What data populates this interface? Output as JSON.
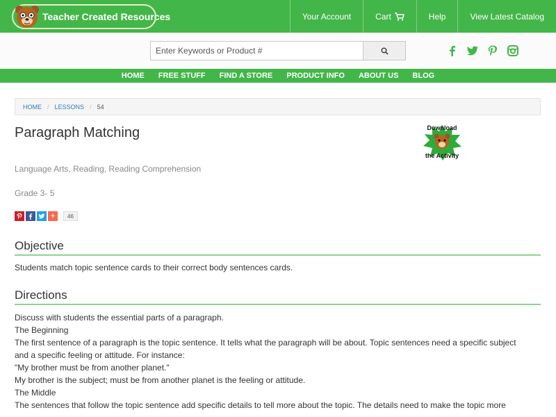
{
  "header": {
    "logo_text": "Teacher Created Resources",
    "nav": [
      {
        "label": "Your Account"
      },
      {
        "label": "Cart"
      },
      {
        "label": "Help"
      },
      {
        "label": "View Latest Catalog"
      }
    ]
  },
  "search": {
    "placeholder": "Enter Keywords or Product #",
    "value": ""
  },
  "social_icons": [
    "facebook-icon",
    "twitter-icon",
    "pinterest-icon",
    "instagram-icon"
  ],
  "main_nav": [
    {
      "label": "HOME"
    },
    {
      "label": "FREE STUFF"
    },
    {
      "label": "FIND A STORE"
    },
    {
      "label": "PRODUCT INFO"
    },
    {
      "label": "ABOUT US"
    },
    {
      "label": "BLOG"
    }
  ],
  "breadcrumb": [
    {
      "label": "HOME"
    },
    {
      "label": "LESSONS"
    },
    {
      "label": "54"
    }
  ],
  "lesson": {
    "title": "Paragraph Matching",
    "download_badge": {
      "line1": "Download",
      "line2": "the Activity"
    },
    "subjects": "Language Arts, Reading, Reading Comprehension",
    "grade": "Grade 3- 5",
    "share_count": "46",
    "objective_heading": "Objective",
    "objective_text": "Students match topic sentence cards to their correct body sentences cards.",
    "directions_heading": "Directions",
    "directions_lines": [
      "Discuss with students the essential parts of a paragraph.",
      "The Beginning",
      "The first sentence of a paragraph is the topic sentence. It tells what the paragraph will be about. Topic sentences need a specific subject",
      "and a specific feeling or attitude. For instance:",
      "\"My brother must be from another planet.\"",
      "My brother is the subject; must be from another planet is the feeling or attitude.",
      "The Middle",
      "The sentences that follow the topic sentence add specific details to tell more about the topic. The details need to make the topic more"
    ]
  },
  "colors": {
    "brand_green": "#43b649",
    "link_blue": "#337ab7",
    "pinterest": "#cb2027",
    "facebook": "#3b5998",
    "twitter": "#1da1f2",
    "addthis": "#f8694d"
  }
}
